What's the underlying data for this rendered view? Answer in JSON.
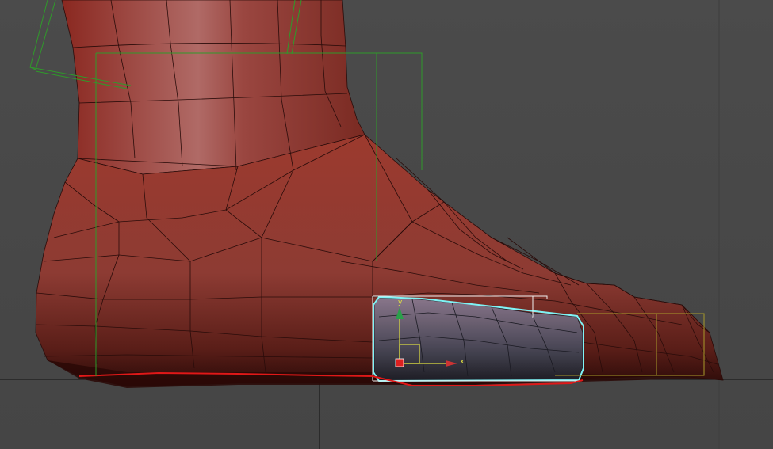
{
  "viewport": {
    "gizmo": {
      "x_label": "x",
      "y_label": "y"
    },
    "colors": {
      "background": "#474747",
      "mesh_base": "#8a3a30",
      "mesh_wire": "#2a0c0a",
      "selection_cyan": "#7ff3f5",
      "bone_green": "#2f9a2a",
      "bone_yellow": "#a89a2a",
      "ground_line": "#111111",
      "gizmo_x": "#cc3333",
      "gizmo_y": "#2aa04a",
      "gizmo_plane": "#e0e040"
    }
  }
}
